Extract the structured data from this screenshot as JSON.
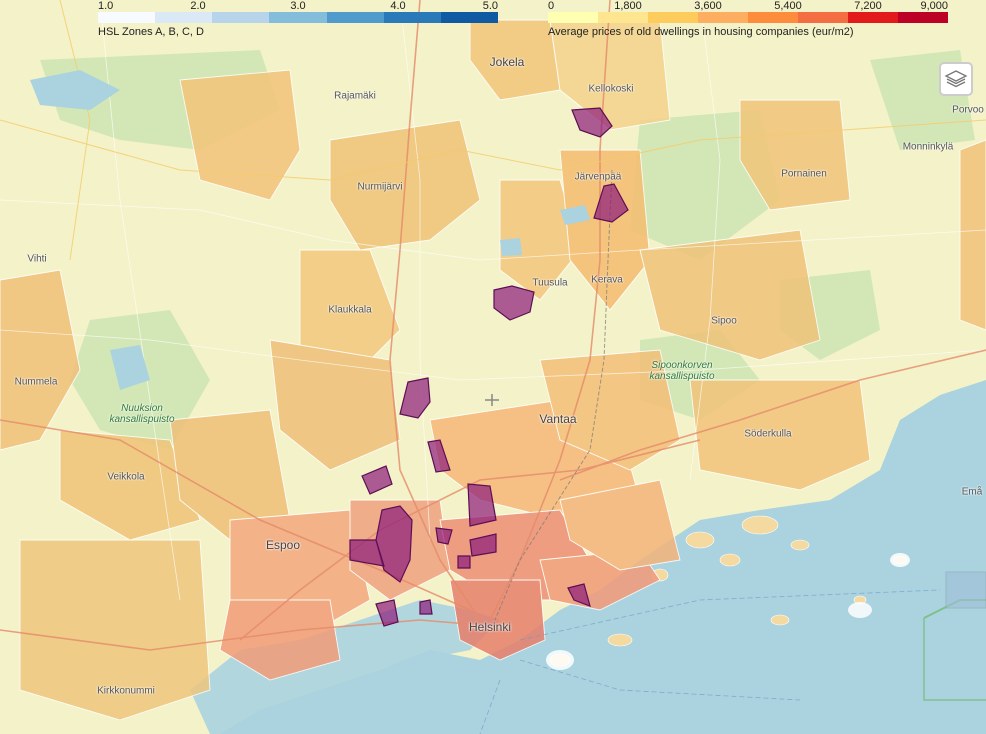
{
  "legend_zones": {
    "ticks": [
      "1.0",
      "2.0",
      "3.0",
      "4.0",
      "5.0"
    ],
    "caption": "HSL Zones A, B, C, D",
    "colors": [
      "#f7fbff",
      "#dbe9f6",
      "#b7d4ea",
      "#84bcdb",
      "#4f9bcb",
      "#2a7ab9",
      "#0f5aa3"
    ]
  },
  "legend_prices": {
    "ticks": [
      "0",
      "1,800",
      "3,600",
      "5,400",
      "7,200",
      "9,000"
    ],
    "caption": "Average prices of old dwellings in housing companies (eur/m2)",
    "colors": [
      "#ffffb2",
      "#fee58f",
      "#fecc5c",
      "#fdae61",
      "#fd8d3c",
      "#f46d43",
      "#e31a1c",
      "#bd0026"
    ]
  },
  "layers_control": {
    "icon": "layers-icon"
  },
  "places": [
    {
      "name": "Jokela",
      "cls": "big"
    },
    {
      "name": "Kellokoski",
      "cls": ""
    },
    {
      "name": "Rajamäki",
      "cls": ""
    },
    {
      "name": "Nurmijärvi",
      "cls": ""
    },
    {
      "name": "Järvenpää",
      "cls": ""
    },
    {
      "name": "Pornainen",
      "cls": ""
    },
    {
      "name": "Monninkylä",
      "cls": ""
    },
    {
      "name": "Porvoo",
      "cls": ""
    },
    {
      "name": "Vihti",
      "cls": ""
    },
    {
      "name": "Tuusula",
      "cls": ""
    },
    {
      "name": "Kerava",
      "cls": ""
    },
    {
      "name": "Klaukkala",
      "cls": ""
    },
    {
      "name": "Sipoo",
      "cls": ""
    },
    {
      "name": "Nummela",
      "cls": ""
    },
    {
      "name": "Sipoonkorven kansallispuisto",
      "cls": "park"
    },
    {
      "name": "Nuuksion kansallispuisto",
      "cls": "park"
    },
    {
      "name": "Vantaa",
      "cls": "big"
    },
    {
      "name": "Söderkulla",
      "cls": ""
    },
    {
      "name": "Veikkola",
      "cls": ""
    },
    {
      "name": "Espoo",
      "cls": "big"
    },
    {
      "name": "Helsinki",
      "cls": "big"
    },
    {
      "name": "Kirkkonummi",
      "cls": ""
    },
    {
      "name": "Emå",
      "cls": ""
    }
  ]
}
